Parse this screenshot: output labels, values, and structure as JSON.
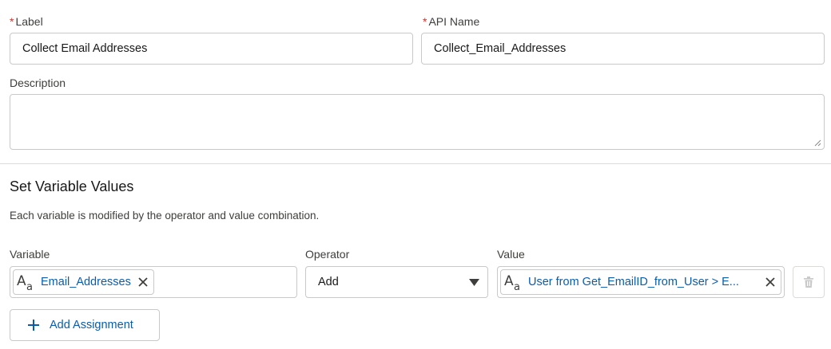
{
  "label_field": {
    "required_mark": "*",
    "label": "Label",
    "value": "Collect Email Addresses"
  },
  "api_name_field": {
    "required_mark": "*",
    "label": "API Name",
    "value": "Collect_Email_Addresses"
  },
  "description_field": {
    "label": "Description",
    "value": ""
  },
  "section": {
    "title": "Set Variable Values",
    "help": "Each variable is modified by the operator and value combination."
  },
  "assignment": {
    "variable_label": "Variable",
    "operator_label": "Operator",
    "value_label": "Value",
    "variable_pill": {
      "icon": "text-type-icon",
      "text": "Email_Addresses"
    },
    "operator_value": "Add",
    "value_pill": {
      "icon": "text-type-icon",
      "text": "User from Get_EmailID_from_User > E..."
    }
  },
  "add_assignment_label": "Add Assignment",
  "colors": {
    "link": "#0b5cab",
    "required": "#c23934",
    "border": "#c9c9c9"
  }
}
